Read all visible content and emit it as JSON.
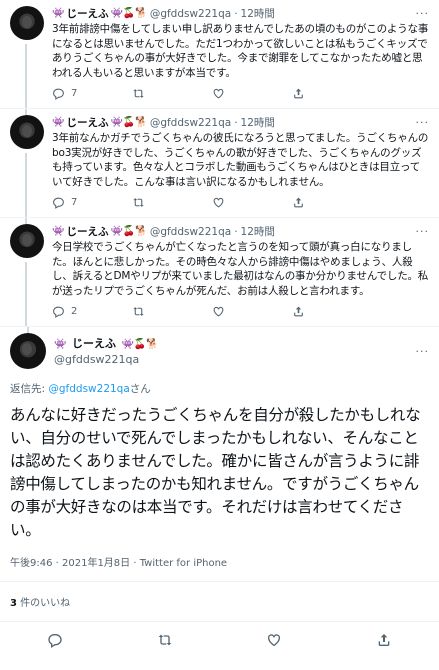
{
  "thread": [
    {
      "display_name": "じーえふ",
      "emoji": "👾🍒🐕",
      "handle": "@gfddsw221qa",
      "dot": "·",
      "time": "12時間",
      "more": "···",
      "text": "3年前誹謗中傷をしてしまい申し訳ありませんでしたあの頃のものがこのような事になるとは思いませんでした。ただ1つわかって欲しいことは私もうごくキッズでありうごくちゃんの事が大好きでした。今まで謝罪をしてこなかったため嘘と思われる人もいると思いますが本当です。",
      "replies": "7",
      "retweets": "",
      "likes": "",
      "share": ""
    },
    {
      "display_name": "じーえふ",
      "emoji": "👾🍒🐕",
      "handle": "@gfddsw221qa",
      "dot": "·",
      "time": "12時間",
      "more": "···",
      "text": "3年前なんかガチでうごくちゃんの彼氏になろうと思ってました。うごくちゃんのbo3実況が好きでした、うごくちゃんの歌が好きでした、うごくちゃんのグッズも持っています。色々な人とコラボした動画もうごくちゃんはひときは目立っていて好きでした。こんな事は言い訳になるかもしれません。",
      "replies": "7",
      "retweets": "",
      "likes": "",
      "share": ""
    },
    {
      "display_name": "じーえふ",
      "emoji": "👾🍒🐕",
      "handle": "@gfddsw221qa",
      "dot": "·",
      "time": "12時間",
      "more": "···",
      "text": "今日学校でうごくちゃんが亡くなったと言うのを知って頭が真っ白になりました。ほんとに悲しかった。その時色々な人から誹謗中傷はやめましょう、人殺し、訴えるとDMやリプが来ていました最初はなんの事か分かりませんでした。私が送ったリプでうごくちゃんが死んだ、お前は人殺しと言われます。",
      "replies": "2",
      "retweets": "",
      "likes": "",
      "share": ""
    }
  ],
  "focus": {
    "display_name": "じーえふ",
    "emoji": "👾🍒🐕",
    "handle": "@gfddsw221qa",
    "more": "···",
    "reply_prefix": "返信先:",
    "reply_mention": "@gfddsw221qa",
    "reply_suffix": "さん",
    "text": "あんなに好きだったうごくちゃんを自分が殺したかもしれない、自分のせいで死んでしまったかもしれない、そんなことは認めたくありませんでした。確かに皆さんが言うように誹謗中傷してしまったのかも知れません。ですがうごくちゃんの事が大好きなのは本当です。それだけは言わせてください。",
    "meta": "午後9:46 · 2021年1月8日 · Twitter for iPhone",
    "likes_count": "3",
    "likes_label": "件のいいね"
  }
}
